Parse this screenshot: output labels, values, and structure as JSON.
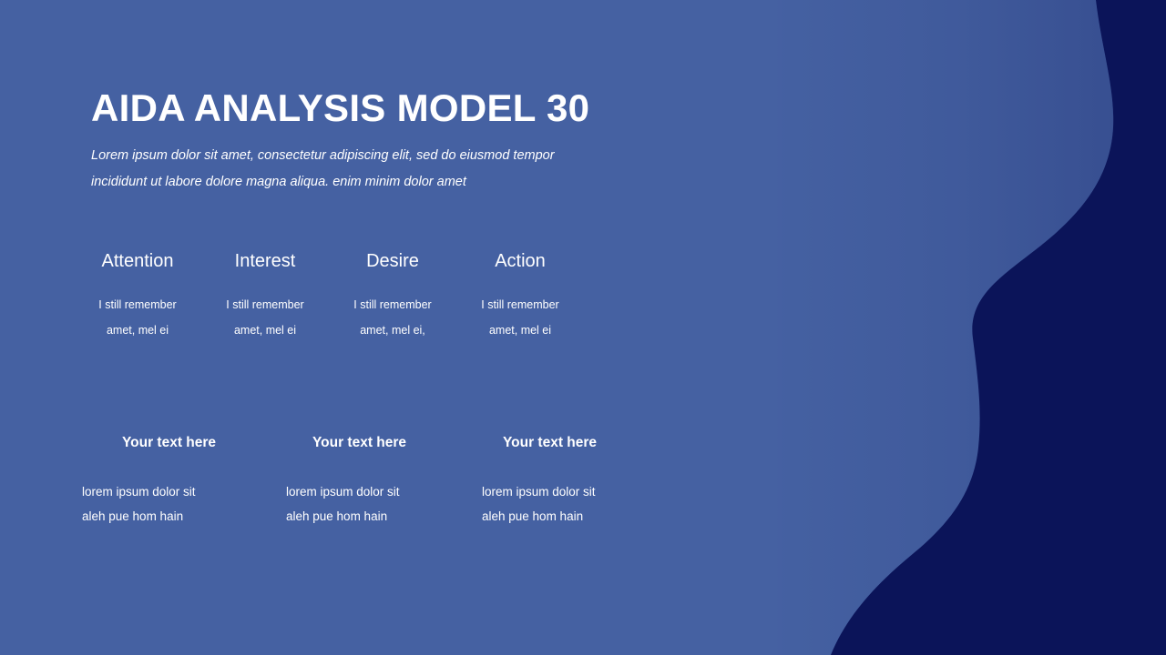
{
  "theme": {
    "background_color": "#4561a2",
    "wave_color": "#0b1459",
    "text_color": "#ffffff"
  },
  "header": {
    "title": "AIDA ANALYSIS MODEL 30",
    "subtitle_line1": "Lorem ipsum dolor sit amet, consectetur adipiscing elit, sed do eiusmod tempor",
    "subtitle_line2": "incididunt ut labore dolore magna aliqua. enim minim dolor amet"
  },
  "aida_stages": [
    {
      "title": "Attention",
      "body_line1": "I still remember",
      "body_line2": "amet, mel ei"
    },
    {
      "title": "Interest",
      "body_line1": "I still remember",
      "body_line2": "amet, mel ei"
    },
    {
      "title": "Desire",
      "body_line1": "I still remember",
      "body_line2": "amet, mel ei,"
    },
    {
      "title": "Action",
      "body_line1": "I still remember",
      "body_line2": "amet, mel ei"
    }
  ],
  "notes": [
    {
      "title": "Your text here",
      "body_line1": "lorem ipsum dolor sit",
      "body_line2": "aleh pue hom hain"
    },
    {
      "title": "Your text here",
      "body_line1": "lorem ipsum dolor sit",
      "body_line2": "aleh pue hom hain"
    },
    {
      "title": "Your text here",
      "body_line1": "lorem ipsum dolor sit",
      "body_line2": "aleh pue hom hain"
    }
  ],
  "decoration": {
    "shape_name": "wave-shape"
  }
}
